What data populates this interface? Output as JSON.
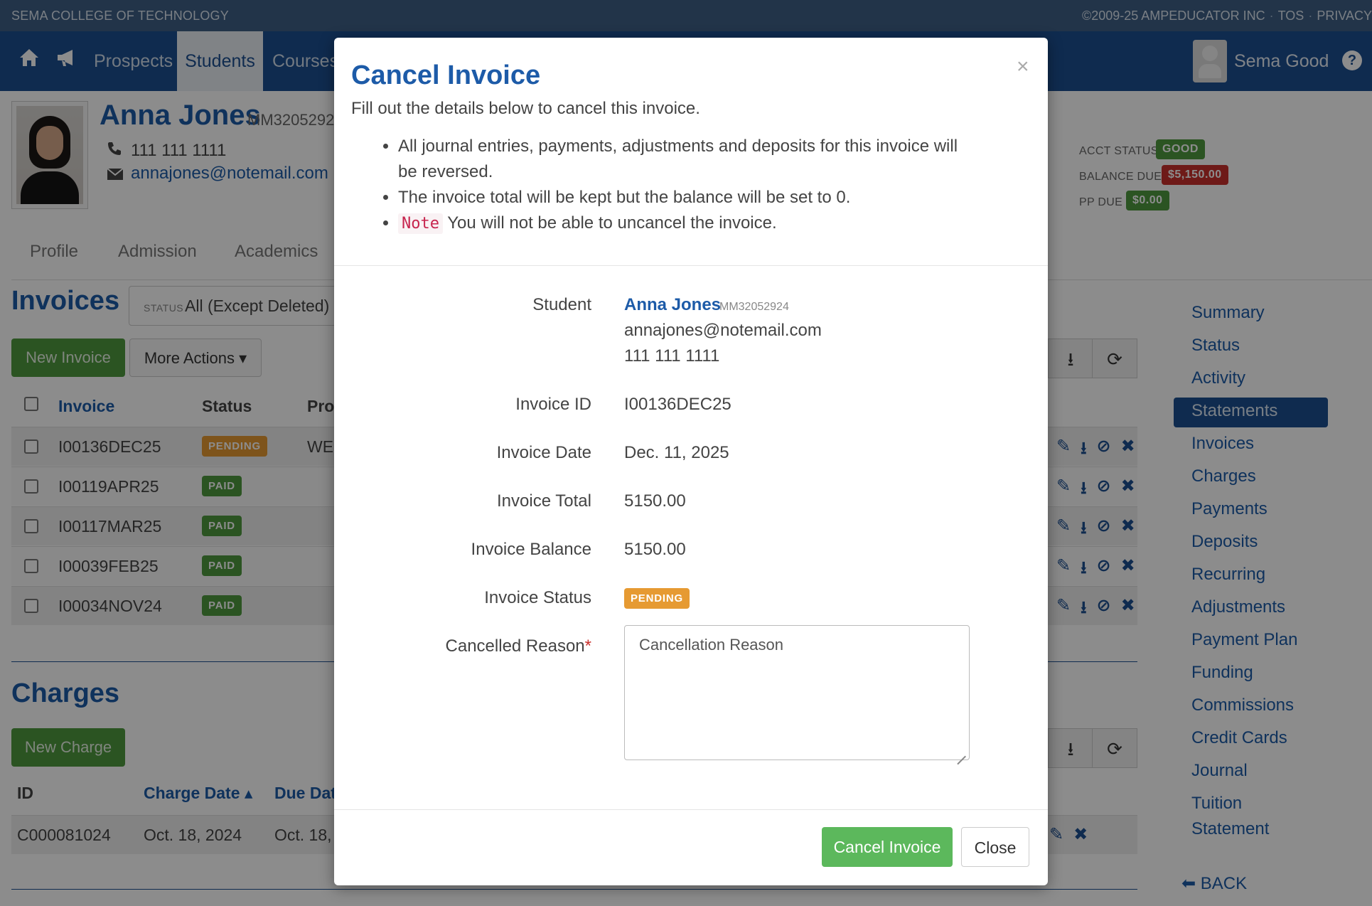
{
  "topbar": {
    "school": "SEMA COLLEGE OF TECHNOLOGY",
    "copyright": "©2009-25 AMPEDUCATOR INC",
    "tos": "TOS",
    "privacy": "PRIVACY"
  },
  "nav": {
    "items": [
      "Prospects",
      "Students",
      "Courses"
    ],
    "active": "Students",
    "user": "Sema Good"
  },
  "student": {
    "name": "Anna Jones",
    "id": "MM3205292",
    "phone": "111 111 1111",
    "email": "annajones@notemail.com"
  },
  "account": {
    "acct_status_label": "ACCT STATUS",
    "acct_status": "GOOD",
    "balance_label": "BALANCE DUE",
    "balance": "$5,150.00",
    "pp_label": "PP DUE",
    "pp": "$0.00",
    "colors": {
      "good": "#4f9a3f",
      "balance": "#c9302c",
      "pp": "#4f9a3f"
    }
  },
  "tabs": [
    "Profile",
    "Admission",
    "Academics"
  ],
  "invoices": {
    "heading": "Invoices",
    "filter_label": "STATUS",
    "filter_value": "All (Except Deleted)",
    "new_button": "New Invoice",
    "more_button": "More Actions ▾",
    "columns": [
      "Invoice",
      "Status",
      "Pro"
    ],
    "rows": [
      {
        "id": "I00136DEC25",
        "status": "PENDING",
        "program": "WEI"
      },
      {
        "id": "I00119APR25",
        "status": "PAID",
        "program": ""
      },
      {
        "id": "I00117MAR25",
        "status": "PAID",
        "program": ""
      },
      {
        "id": "I00039FEB25",
        "status": "PAID",
        "program": ""
      },
      {
        "id": "I00034NOV24",
        "status": "PAID",
        "program": ""
      }
    ]
  },
  "charges": {
    "heading": "Charges",
    "new_button": "New Charge",
    "columns": [
      "ID",
      "Charge Date ▴",
      "Due Dat"
    ],
    "rows": [
      {
        "id": "C000081024",
        "charge_date": "Oct. 18, 2024",
        "due_date": "Oct. 18,"
      }
    ]
  },
  "sidebar": {
    "items": [
      "Summary",
      "Status",
      "Activity",
      "Statements",
      "Invoices",
      "Charges",
      "Payments",
      "Deposits",
      "Recurring",
      "Adjustments",
      "Payment Plan",
      "Funding",
      "Commissions",
      "Credit Cards",
      "Journal",
      "Tuition",
      "Statement"
    ],
    "active": "Statements",
    "back": "BACK"
  },
  "modal": {
    "title": "Cancel Invoice",
    "close_x": "×",
    "intro": "Fill out the details below to cancel this invoice.",
    "bullets": [
      "All journal entries, payments, adjustments and deposits for this invoice will be reversed.",
      "The invoice total will be kept but the balance will be set to 0."
    ],
    "note_tag": "Note",
    "note_text": "You will not be able to uncancel the invoice.",
    "labels": {
      "student": "Student",
      "invoice_id": "Invoice ID",
      "invoice_date": "Invoice Date",
      "invoice_total": "Invoice Total",
      "invoice_balance": "Invoice Balance",
      "invoice_status": "Invoice Status",
      "cancelled_reason": "Cancelled Reason"
    },
    "values": {
      "student_name": "Anna Jones",
      "student_id": "MM32052924",
      "student_email": "annajones@notemail.com",
      "student_phone": "111 111 1111",
      "invoice_id": "I00136DEC25",
      "invoice_date": "Dec. 11, 2025",
      "invoice_total": "5150.00",
      "invoice_balance": "5150.00",
      "invoice_status": "PENDING"
    },
    "required_mark": "*",
    "reason_placeholder": "Cancellation Reason",
    "submit_button": "Cancel Invoice",
    "close_button": "Close"
  },
  "colors": {
    "brand": "#1d4f91",
    "link": "#1d5ba8",
    "pending": "#e69a32",
    "paid": "#4f9a3f",
    "success_button": "#5cb85c"
  }
}
